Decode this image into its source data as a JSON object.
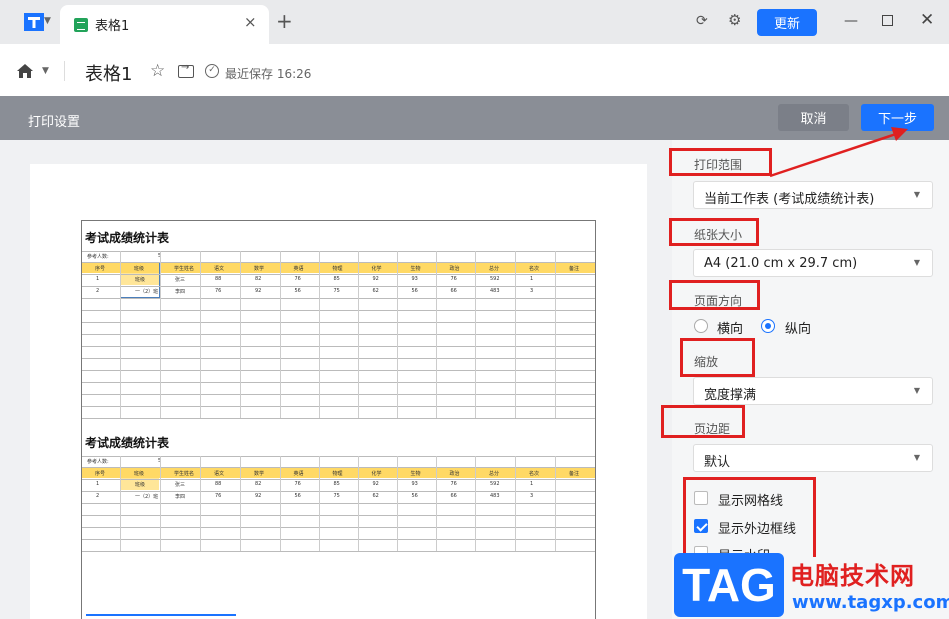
{
  "titlebar": {
    "tab_title": "表格1",
    "close_glyph": "×",
    "add_glyph": "+",
    "update_label": "更新",
    "minimize_glyph": "—",
    "close_window_glyph": "✕"
  },
  "docbar": {
    "title": "表格1",
    "saved_text": "最近保存 16:26"
  },
  "print": {
    "title": "打印设置",
    "cancel_label": "取消",
    "next_label": "下一步"
  },
  "sheet": {
    "title": "考试成绩统计表",
    "count_label": "参考人数:",
    "count_value": "5",
    "headers": [
      "序号",
      "班级",
      "学生姓名",
      "语文",
      "数学",
      "英语",
      "物理",
      "化学",
      "生物",
      "政治",
      "总分",
      "名次",
      "备注"
    ],
    "rows": [
      [
        "1",
        "班级",
        "张三",
        "88",
        "82",
        "76",
        "85",
        "92",
        "93",
        "76",
        "592",
        "1",
        ""
      ],
      [
        "2",
        "一（2）班",
        "李四",
        "76",
        "92",
        "56",
        "75",
        "62",
        "56",
        "66",
        "483",
        "3",
        ""
      ]
    ]
  },
  "settings": {
    "range": {
      "label": "打印范围",
      "value": "当前工作表 (考试成绩统计表)"
    },
    "paper": {
      "label": "纸张大小",
      "value": "A4 (21.0 cm x 29.7 cm)"
    },
    "orientation": {
      "label": "页面方向",
      "landscape": "横向",
      "portrait": "纵向",
      "selected": "纵向"
    },
    "scale": {
      "label": "缩放",
      "value": "宽度撑满"
    },
    "margin": {
      "label": "页边距",
      "value": "默认"
    },
    "options": [
      {
        "label": "显示网格线",
        "checked": false
      },
      {
        "label": "显示外边框线",
        "checked": true
      },
      {
        "label": "显示水印",
        "checked": false
      }
    ]
  },
  "watermark": {
    "tag": "TAG",
    "site_name": "电脑技术网",
    "url": "www.tagxp.com"
  },
  "colors": {
    "accent": "#1a73ff",
    "annotation_red": "#e02020",
    "header_yellow": "#ffd965",
    "print_bar": "#8a8e96"
  }
}
